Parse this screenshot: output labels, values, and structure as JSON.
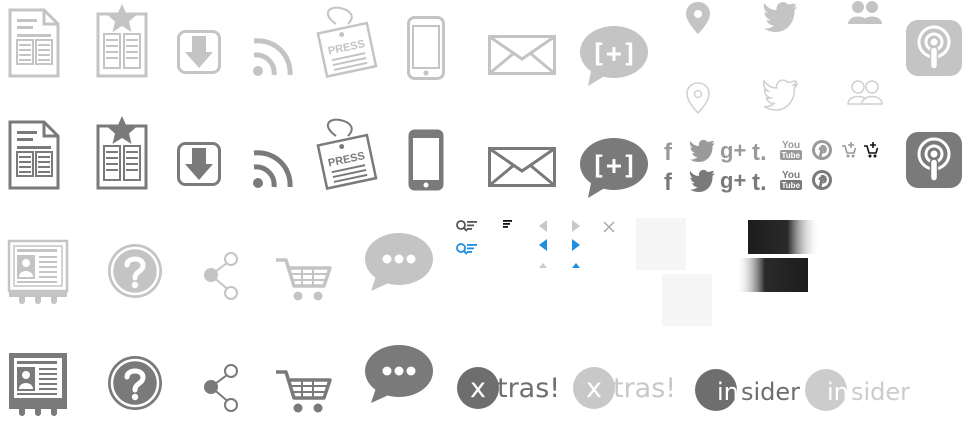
{
  "labels": {
    "press": "PRESS",
    "plus_bubble": "[+]",
    "facebook": "f",
    "tumblr": "t.",
    "gplus": "g+",
    "youtube_top": "You",
    "youtube_bottom": "Tube",
    "xtras_x": "x",
    "xtras_rest": "tras!",
    "insider_in": "in",
    "insider_rest": "sider"
  },
  "colors": {
    "light": "#c4c4c4",
    "dark": "#7a7a7a",
    "active_blue": "#1e8fe0",
    "black": "#111111"
  },
  "icons": [
    "document-icon",
    "starred-document-icon",
    "download-icon",
    "rss-icon",
    "press-tag-icon",
    "mobile-phone-icon",
    "envelope-icon",
    "plus-bubble-icon",
    "location-pin-icon",
    "twitter-bird-icon",
    "people-icon",
    "podcast-icon",
    "facebook-icon",
    "gplus-icon",
    "tumblr-icon",
    "youtube-icon",
    "pinterest-icon",
    "cart-add-icon",
    "search-filter-icon",
    "sort-icon",
    "arrow-left-icon",
    "arrow-right-icon",
    "close-icon",
    "caret-up-icon",
    "noise-texture",
    "dark-gradient-bar",
    "profile-card-icon",
    "help-circle-icon",
    "share-icon",
    "shopping-cart-icon",
    "ellipsis-bubble-icon",
    "xtras-logo",
    "insider-logo"
  ]
}
